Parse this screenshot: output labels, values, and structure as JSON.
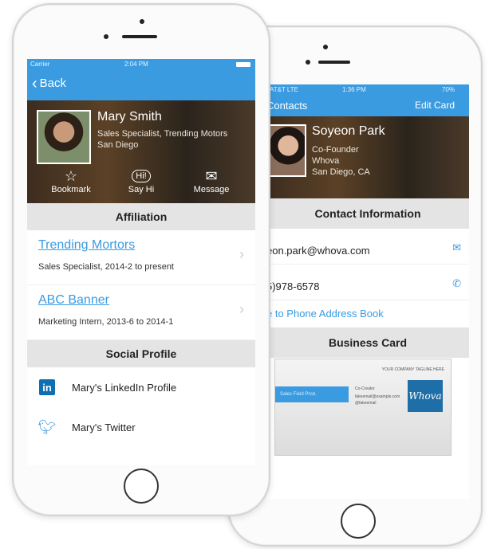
{
  "back_phone": {
    "status": {
      "carrier": "AT&T  LTE",
      "time": "1:36 PM",
      "battery": "70%"
    },
    "nav": {
      "title": "Contacts",
      "edit_label": "Edit Card"
    },
    "profile": {
      "name": "Soyeon Park",
      "lines": [
        "Co-Founder",
        "Whova",
        "San Diego, CA"
      ]
    },
    "contact_header": "Contact Information",
    "contact_rows": [
      {
        "value": "eon.park@whova.com",
        "icon": "mail-icon"
      },
      {
        "value": "5)978-6578",
        "icon": "phone-icon"
      }
    ],
    "save_label": "e to Phone Address Book",
    "business_card_header": "Business Card",
    "card": {
      "title_line": "YOUR COMPANY TAGLINE HERE",
      "stripe": "Sales Field Prod.",
      "name": "Co-Creator",
      "email": "fakeemail@example.com",
      "extra": "@fakeemail",
      "logo": "Whova"
    }
  },
  "front_phone": {
    "status": {
      "carrier": "Carrier",
      "time": "2:04 PM"
    },
    "nav": {
      "back_label": "Back"
    },
    "profile": {
      "name": "Mary Smith",
      "lines": [
        "Sales Specialist, Trending Motors",
        "San Diego"
      ]
    },
    "actions": [
      {
        "label": "Bookmark",
        "icon": "star-icon"
      },
      {
        "label": "Say Hi",
        "icon": "hi-icon"
      },
      {
        "label": "Message",
        "icon": "envelope-icon"
      }
    ],
    "affiliation_header": "Affiliation",
    "affiliations": [
      {
        "company": "Trending Mortors",
        "role": "Sales Specialist, 2014-2 to present"
      },
      {
        "company": "ABC Banner",
        "role": "Marketing Intern, 2013-6 to 2014-1"
      }
    ],
    "social_header": "Social Profile",
    "social": [
      {
        "label": "Mary's LinkedIn Profile",
        "icon": "linkedin-icon"
      },
      {
        "label": "Mary's Twitter",
        "icon": "twitter-icon"
      }
    ]
  },
  "colors": {
    "accent": "#3a9be0",
    "section_bg": "#e4e4e4",
    "linkedin": "#0e6fb1"
  }
}
